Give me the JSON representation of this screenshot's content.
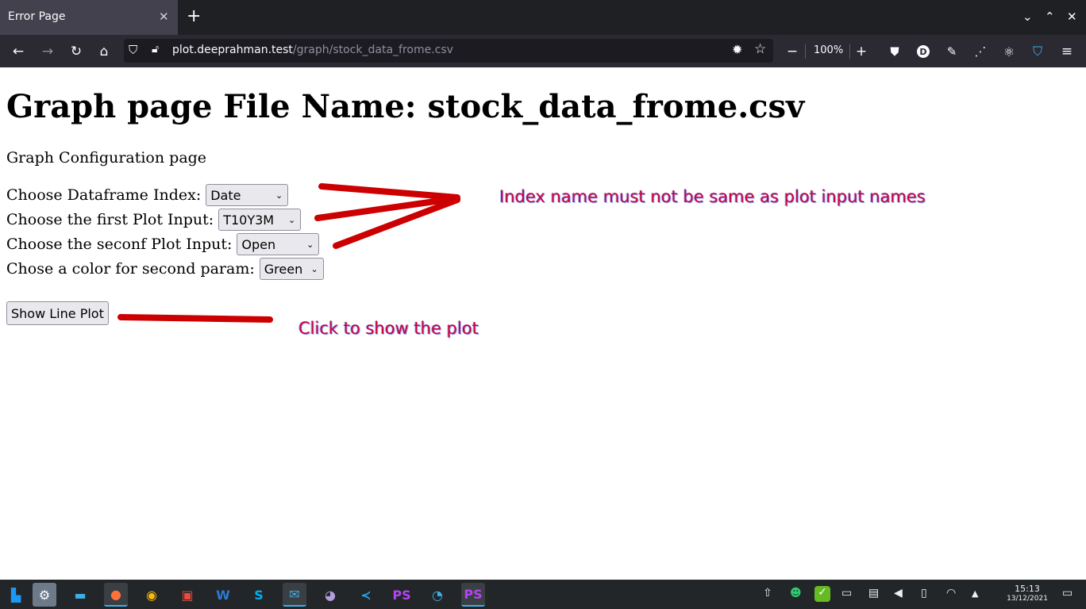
{
  "browser": {
    "tab_title": "Error Page",
    "url_host": "plot.deeprahman.test",
    "url_path": "/graph/stock_data_frome.csv",
    "zoom": "100%"
  },
  "page": {
    "heading": "Graph page File Name: stock_data_frome.csv",
    "subtitle": "Graph Configuration page",
    "index_label": "Choose Dataframe Index:",
    "index_value": "Date",
    "first_label": "Choose the first Plot Input:",
    "first_value": "T10Y3M",
    "second_label": "Choose the seconf Plot Input:",
    "second_value": "Open",
    "color_label": "Chose a color for second param:",
    "color_value": "Green",
    "show_button": "Show Line Plot"
  },
  "annotations": {
    "note_index": "Index name must not be same as plot input names",
    "note_click": "Click to show the plot",
    "color": "#cc0000"
  },
  "taskbar": {
    "time": "15:13",
    "date": "13/12/2021"
  }
}
